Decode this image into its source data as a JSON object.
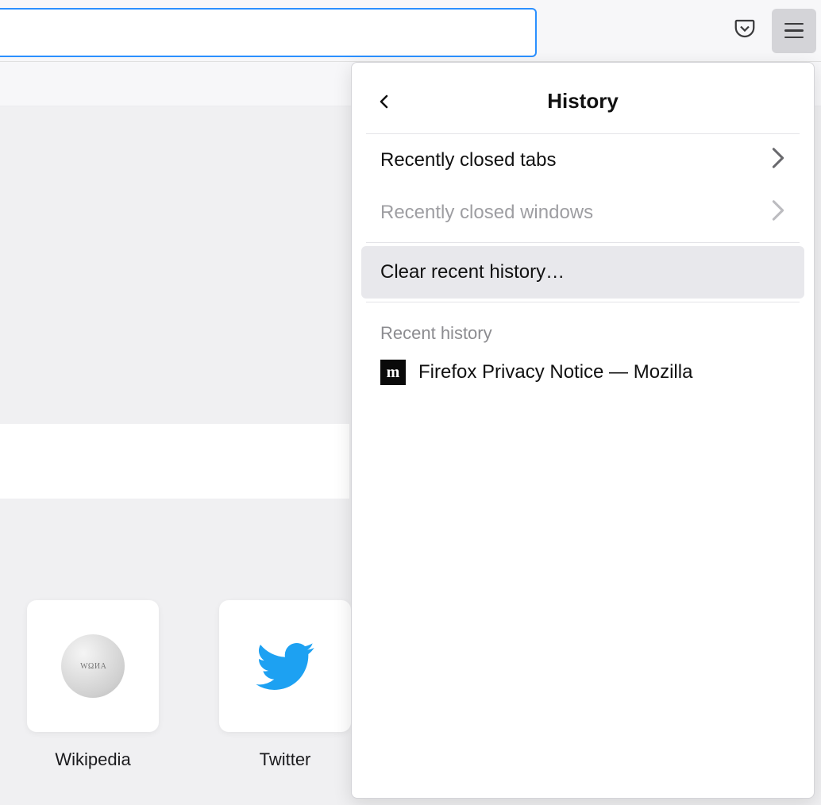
{
  "panel": {
    "title": "History",
    "recently_closed_tabs": "Recently closed tabs",
    "recently_closed_windows": "Recently closed windows",
    "clear_recent": "Clear recent history…",
    "recent_history_label": "Recent history",
    "entries": [
      {
        "title": "Firefox Privacy Notice — Mozilla",
        "favicon_letter": "m"
      }
    ]
  },
  "topsites": [
    {
      "name": "Wikipedia",
      "icon": "wikipedia"
    },
    {
      "name": "Twitter",
      "icon": "twitter"
    }
  ]
}
